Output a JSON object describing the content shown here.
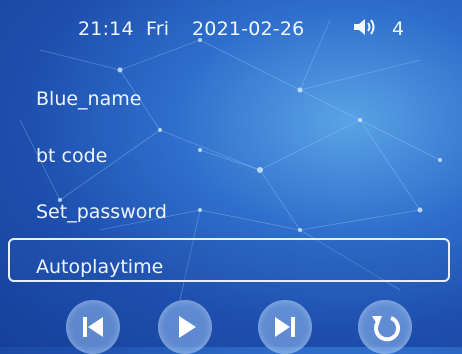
{
  "status": {
    "time": "21:14",
    "day": "Fri",
    "date": "2021-02-26",
    "volume_icon": "speaker-icon",
    "volume_level": "4"
  },
  "menu": {
    "items": [
      {
        "label": "Blue_name"
      },
      {
        "label": "bt code"
      },
      {
        "label": "Set_password"
      },
      {
        "label": "Autoplaytime",
        "selected": true
      }
    ]
  },
  "controls": [
    {
      "icon": "skip-previous-icon"
    },
    {
      "icon": "play-icon"
    },
    {
      "icon": "skip-next-icon"
    },
    {
      "icon": "return-icon"
    }
  ],
  "colors": {
    "background": "#2f6fcc",
    "text": "#eef4ff",
    "selection_border": "#e7f0ff"
  }
}
